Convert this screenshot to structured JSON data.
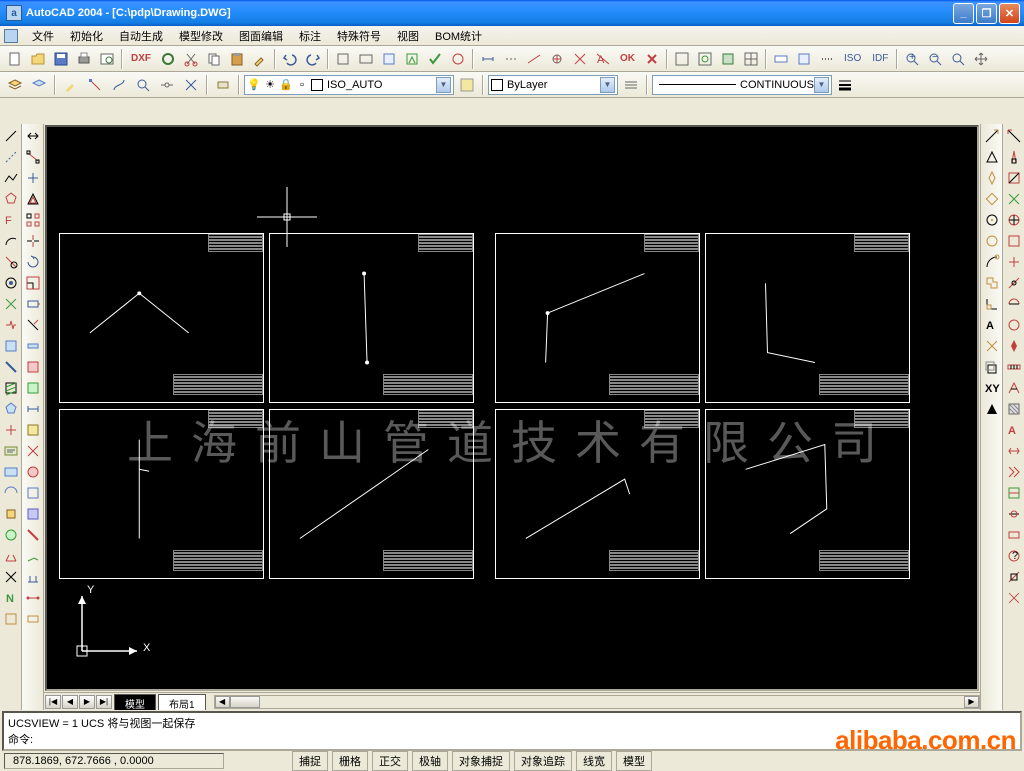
{
  "title": "AutoCAD 2004 - [C:\\pdp\\Drawing.DWG]",
  "app_icon_letter": "a",
  "menu": {
    "file": "文件",
    "init": "初始化",
    "autogen": "自动生成",
    "modelmod": "模型修改",
    "drawedit": "图面编辑",
    "annotate": "标注",
    "special": "特殊符号",
    "view": "视图",
    "bom": "BOM统计"
  },
  "toolbar3_texts": {
    "iso": "ISO",
    "idf": "IDF"
  },
  "toolbar1_text": {
    "dxf": "DXF",
    "ok": "OK"
  },
  "propbar": {
    "layer_value": "ISO_AUTO",
    "color_value": "ByLayer",
    "linetype_value": "CONTINUOUS"
  },
  "tabs": {
    "model": "模型",
    "layout1": "布局1"
  },
  "tab_arrows": {
    "first": "|◀",
    "prev": "◀",
    "next": "▶",
    "last": "▶|"
  },
  "cmdline": {
    "line1": "UCSVIEW = 1  UCS 将与视图一起保存",
    "line2": "命令:"
  },
  "status": {
    "coords": "878.1869,  672.7666 , 0.0000",
    "snap": "捕捉",
    "grid": "栅格",
    "ortho": "正交",
    "polar": "极轴",
    "osnap": "对象捕捉",
    "otrack": "对象追踪",
    "lwt": "线宽",
    "model": "模型"
  },
  "ucs": {
    "x": "X",
    "y": "Y"
  },
  "watermark": "alibaba.com.cn",
  "watermark_cn": "上海前山管道技术有限公司"
}
